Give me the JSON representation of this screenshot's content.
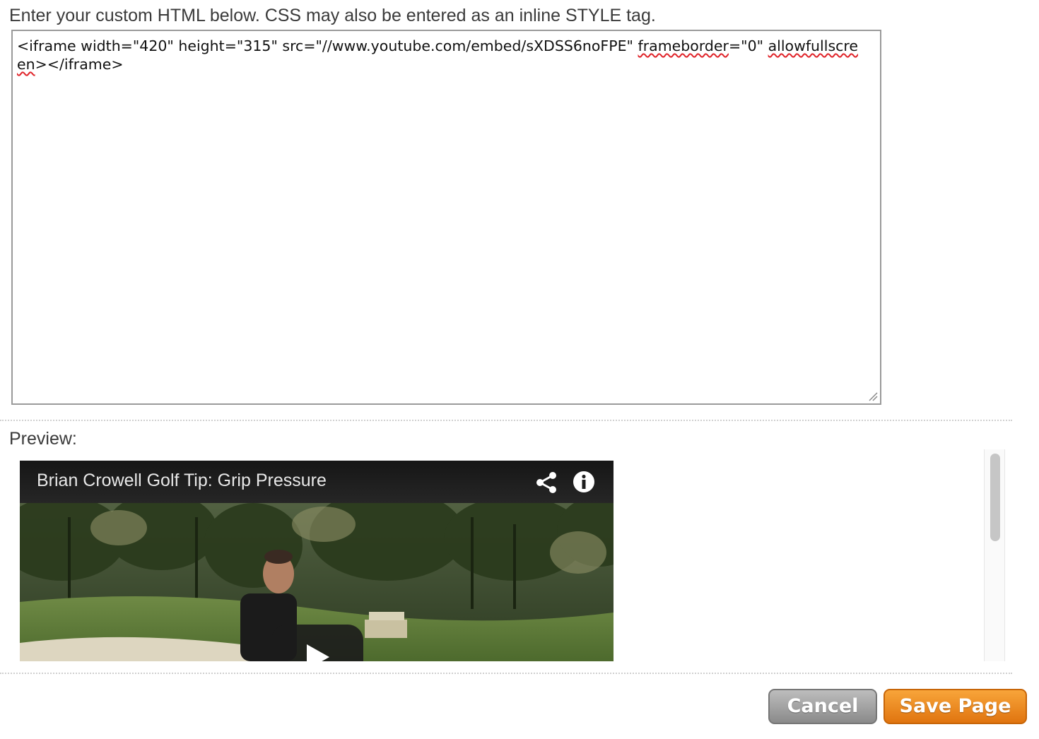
{
  "instructions": "Enter your custom HTML below. CSS may also be entered as an inline STYLE tag.",
  "editor": {
    "code_part1": "<iframe width=\"420\" height=\"315\" src=\"//www.youtube.com/embed/sXDSS6noFPE\" ",
    "code_spell1": "frameborder",
    "code_part2": "=\"0\" ",
    "code_spell2": "allowfullscreen",
    "code_part3": "></iframe>"
  },
  "preview": {
    "label": "Preview:",
    "video_title": "Brian Crowell Golf Tip: Grip Pressure"
  },
  "buttons": {
    "cancel_label": "Cancel",
    "save_label": "Save Page"
  },
  "colors": {
    "save_button": "#f08a1e",
    "cancel_button": "#9c9c9c",
    "spellcheck_underline": "#e0242a"
  },
  "icons": {
    "share": "share-icon",
    "info": "info-icon",
    "play": "play-icon",
    "resize": "resize-handle-icon"
  }
}
